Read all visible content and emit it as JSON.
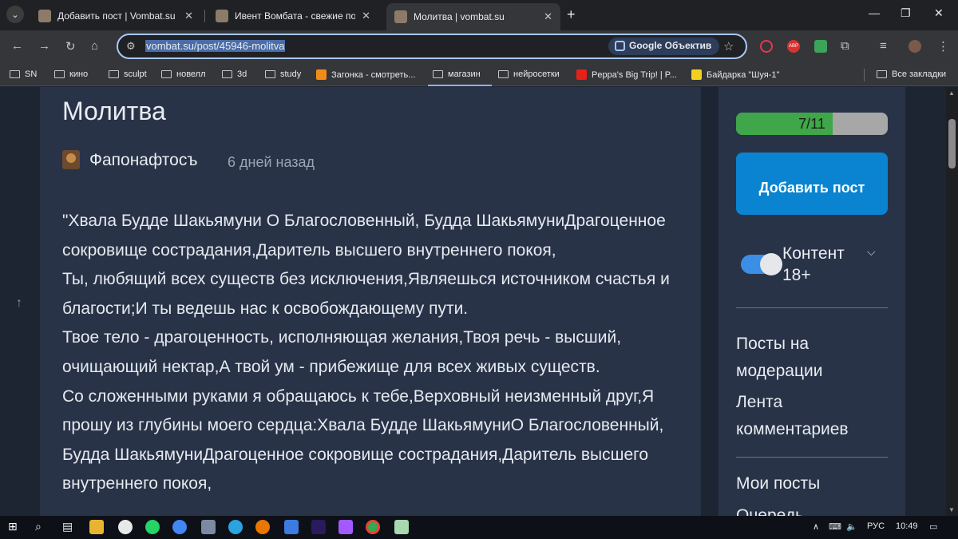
{
  "browser": {
    "tabs": [
      {
        "title": "Добавить пост | Vombat.su",
        "active": false
      },
      {
        "title": "Ивент Вомбата - свежие посты",
        "active": false
      },
      {
        "title": "Молитва | vombat.su",
        "active": true
      }
    ],
    "url": "vombat.su/post/45946-molitva",
    "lens_label": "Google Объектив",
    "bookmarks": [
      "SN",
      "кино",
      "sculpt",
      "новелл",
      "3d",
      "study",
      "Загонка - смотреть...",
      "магазин",
      "нейросетки",
      "Peppa's Big Trip! | P...",
      "Байдарка \"Шуя-1\""
    ],
    "all_bookmarks": "Все закладки",
    "abp_label": "ABP",
    "colors": {
      "accent": "#a8c7fa",
      "tab_bg": "#202124",
      "toolbar_bg": "#35363a"
    }
  },
  "post": {
    "title": "Молитва",
    "author": "Фапонафтосъ",
    "date": "6 дней назад",
    "body": [
      "\"Хвала Будде Шакьямуни О Благословенный, Будда ШакьямуниДрагоценное сокровище сострадания,Даритель высшего внутреннего покоя,",
      "Ты, любящий всех существ без исключения,Являешься источником счастья и благости;И ты ведешь нас к освобождающему пути.",
      "Твое тело - драгоценность, исполняющая желания,Твоя речь - высший, очищающий нектар,А твой ум - прибежище для всех живых существ.",
      "Со сложенными руками я обращаюсь к тебе,Верховный неизменный друг,Я прошу из глубины моего сердца:Хвала Будде ШакьямуниО Благословенный, Будда ШакьямуниДрагоценное сокровище сострадания,Даритель высшего внутреннего покоя,"
    ]
  },
  "sidebar": {
    "progress_label": "7/11",
    "progress_value": 0.636,
    "add_post_label": "Добавить пост",
    "content_toggle_label": "Контент 18+",
    "content_toggle_on": true,
    "links_group1": [
      "Посты на модерации",
      "Лента комментариев"
    ],
    "links_group2": [
      "Мои посты",
      "Очередь"
    ],
    "colors": {
      "progress_fill": "#3fa749",
      "button": "#0a84d0",
      "toggle": "#3a8ee6"
    }
  },
  "taskbar": {
    "lang": "РУС",
    "time": "10:49"
  }
}
